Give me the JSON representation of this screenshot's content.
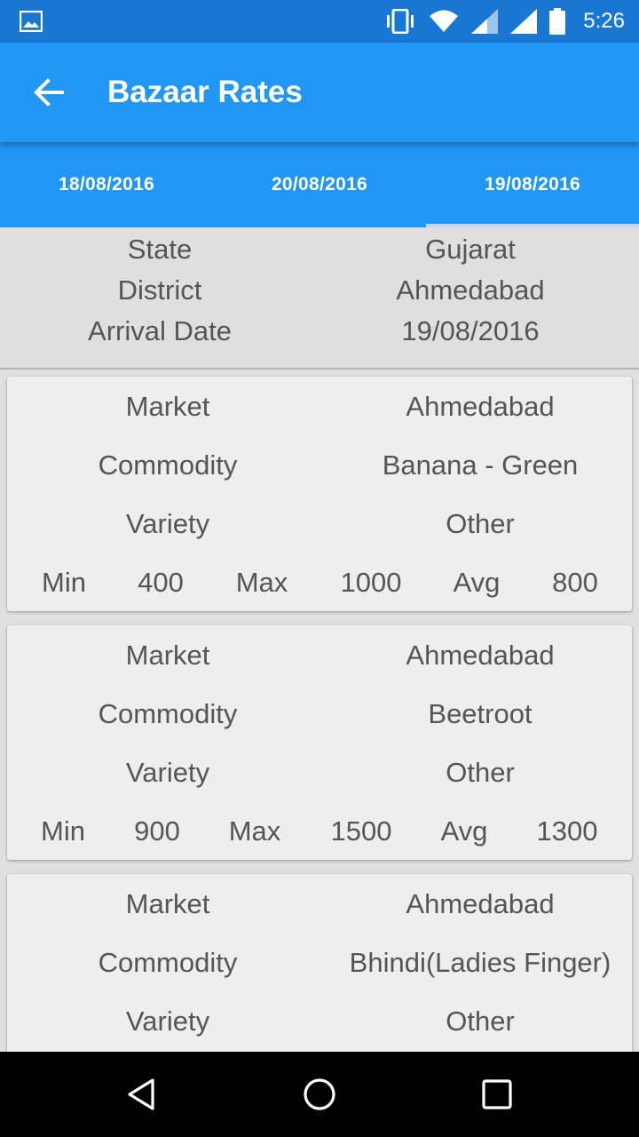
{
  "status_bar": {
    "time": "5:26",
    "icons": [
      "image-icon",
      "vibrate-icon",
      "wifi-icon",
      "signal-icon",
      "signal-full-icon",
      "battery-icon"
    ]
  },
  "app_bar": {
    "title": "Bazaar Rates",
    "back_icon": "arrow-back-icon"
  },
  "tabs": [
    {
      "label": "18/08/2016",
      "active": false
    },
    {
      "label": "20/08/2016",
      "active": false
    },
    {
      "label": "19/08/2016",
      "active": true
    }
  ],
  "summary": {
    "state_label": "State",
    "state_value": "Gujarat",
    "district_label": "District",
    "district_value": "Ahmedabad",
    "arrival_label": "Arrival Date",
    "arrival_value": "19/08/2016"
  },
  "cards": [
    {
      "market_label": "Market",
      "market": "Ahmedabad",
      "commodity_label": "Commodity",
      "commodity": "Banana - Green",
      "variety_label": "Variety",
      "variety": "Other",
      "min_label": "Min",
      "min": "400",
      "max_label": "Max",
      "max": "1000",
      "avg_label": "Avg",
      "avg": "800"
    },
    {
      "market_label": "Market",
      "market": "Ahmedabad",
      "commodity_label": "Commodity",
      "commodity": "Beetroot",
      "variety_label": "Variety",
      "variety": "Other",
      "min_label": "Min",
      "min": "900",
      "max_label": "Max",
      "max": "1500",
      "avg_label": "Avg",
      "avg": "1300"
    },
    {
      "market_label": "Market",
      "market": "Ahmedabad",
      "commodity_label": "Commodity",
      "commodity": "Bhindi(Ladies Finger)",
      "variety_label": "Variety",
      "variety": "Other"
    }
  ],
  "nav_bar": {
    "icons": [
      "back-triangle-icon",
      "home-circle-icon",
      "recents-square-icon"
    ]
  },
  "colors": {
    "status_bar": "#1976d2",
    "app_bar": "#2196f3",
    "tab_indicator": "#c7d4f5",
    "card_bg": "#eeeeee",
    "text": "#555555"
  }
}
